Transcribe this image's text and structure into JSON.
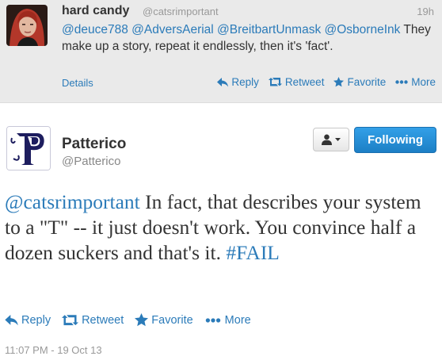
{
  "parent_tweet": {
    "name": "hard candy",
    "handle": "@catsrimportant",
    "time": "19h",
    "text_mentions": "@deuce788 @AdversAerial @BreitbartUnmask @OsborneInk",
    "text_body": " They make up a story, repeat it endlessly, then it's 'fact'.",
    "details_label": "Details",
    "actions": {
      "reply": "Reply",
      "retweet": "Retweet",
      "favorite": "Favorite",
      "more": "More"
    }
  },
  "main_tweet": {
    "name": "Patterico",
    "handle": "@Patterico",
    "follow_label": "Following",
    "text_mention": "@catsrimportant",
    "text_body_1": " In fact, that describes your system to a \"T\" -- it just doesn't work. You convince half a dozen suckers and that's it. ",
    "text_hashtag": "#FAIL",
    "actions": {
      "reply": "Reply",
      "retweet": "Retweet",
      "favorite": "Favorite",
      "more": "More"
    },
    "timestamp": "11:07 PM - 19 Oct 13"
  },
  "colors": {
    "link": "#2b7bb9",
    "follow_button": "#2a8fd6",
    "parent_bg": "#eaeaea"
  },
  "icons": [
    "reply-icon",
    "retweet-icon",
    "favorite-star-icon",
    "more-dots-icon",
    "user-icon",
    "caret-down-icon"
  ]
}
